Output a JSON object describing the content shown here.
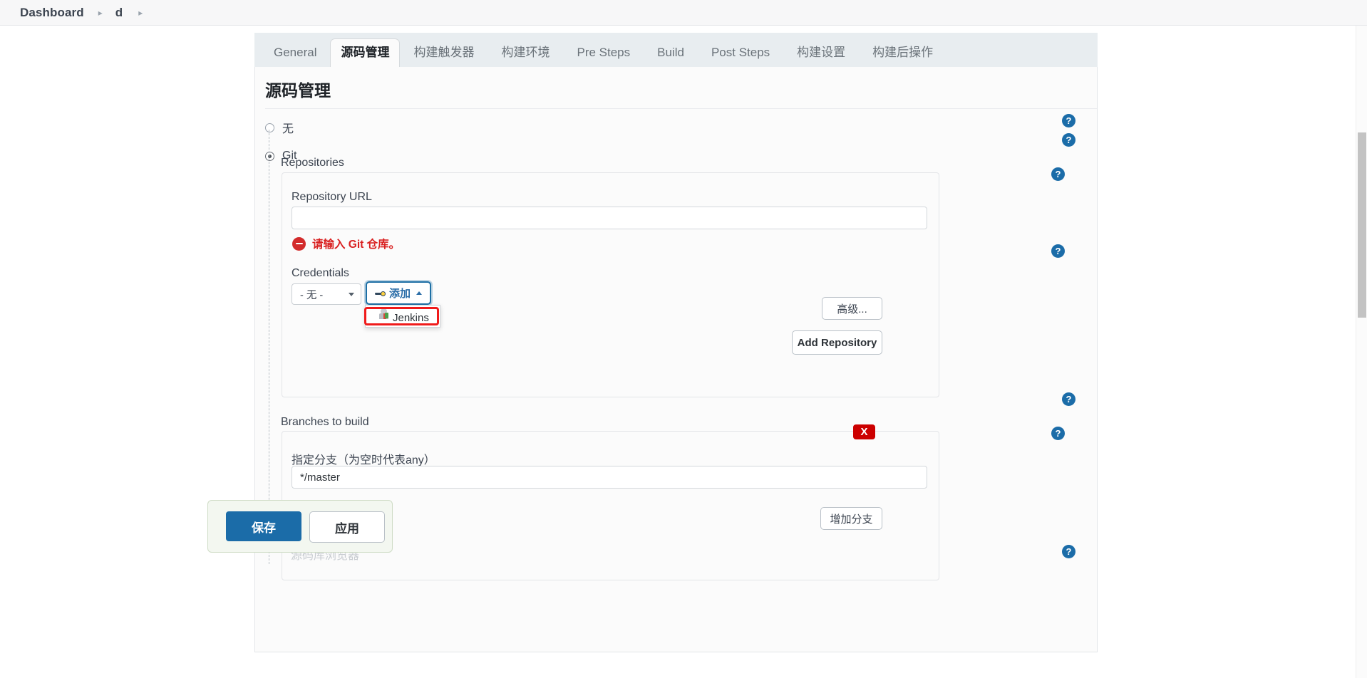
{
  "breadcrumb": {
    "items": [
      {
        "label": "Dashboard"
      },
      {
        "label": "d"
      }
    ],
    "separator": "▸"
  },
  "tabs": [
    {
      "label": "General",
      "active": false
    },
    {
      "label": "源码管理",
      "active": true
    },
    {
      "label": "构建触发器",
      "active": false
    },
    {
      "label": "构建环境",
      "active": false
    },
    {
      "label": "Pre Steps",
      "active": false
    },
    {
      "label": "Build",
      "active": false
    },
    {
      "label": "Post Steps",
      "active": false
    },
    {
      "label": "构建设置",
      "active": false
    },
    {
      "label": "构建后操作",
      "active": false
    }
  ],
  "section": {
    "title": "源码管理",
    "scm_options": [
      {
        "label": "无",
        "selected": false
      },
      {
        "label": "Git",
        "selected": true
      }
    ]
  },
  "repositories": {
    "label": "Repositories",
    "repository_url": {
      "label": "Repository URL",
      "value": "",
      "placeholder": ""
    },
    "error": {
      "icon": "error-circle-minus-icon",
      "text": "请输入 Git 仓库。"
    },
    "credentials": {
      "label": "Credentials",
      "selected": "- 无 -",
      "options": [
        "- 无 -"
      ],
      "add_button": {
        "label": "添加",
        "icon": "key-icon",
        "chevron": "chevron-up-icon",
        "expanded": true
      },
      "dropdown_items": [
        {
          "label": "Jenkins",
          "icon": "jenkins-icon",
          "highlighted": true
        }
      ]
    },
    "advanced_button": "高级...",
    "add_repository_button": "Add Repository"
  },
  "branches": {
    "label": "Branches to build",
    "delete_badge": "X",
    "branch_specifier": {
      "label": "指定分支（为空时代表any）",
      "value": "*/master"
    },
    "add_branch_button": "增加分支"
  },
  "background_text": {
    "browser_label": "源码库浏览器"
  },
  "footer": {
    "save_label": "保存",
    "apply_label": "应用"
  },
  "help_icon": "?",
  "colors": {
    "accent": "#1b6ca8",
    "error": "#d92020",
    "delete": "#cc0000",
    "annotation": "#f01b1b",
    "tabbar": "#e8edf0"
  }
}
